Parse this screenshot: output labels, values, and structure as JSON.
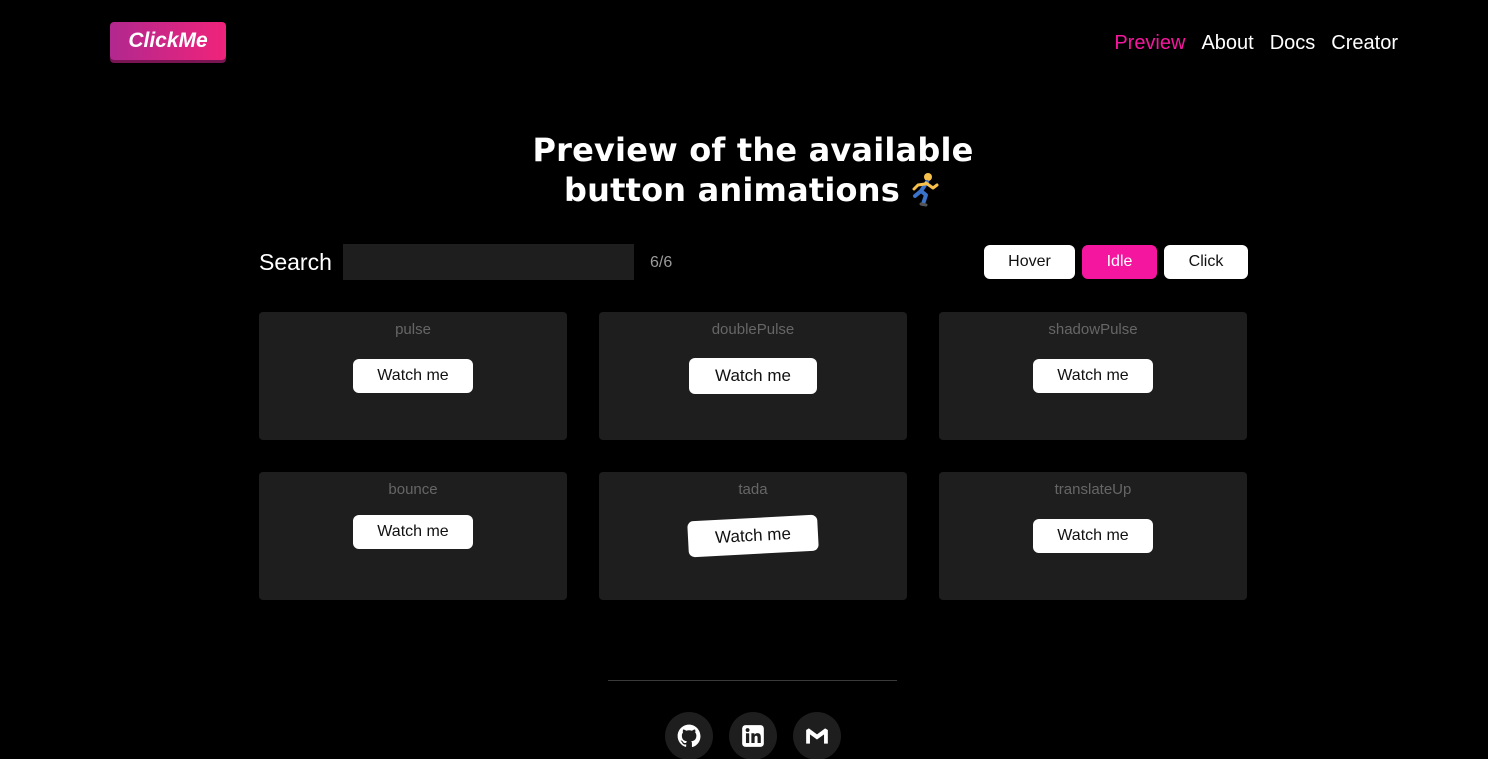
{
  "header": {
    "logo": "ClickMe",
    "nav": [
      {
        "label": "Preview",
        "active": true
      },
      {
        "label": "About",
        "active": false
      },
      {
        "label": "Docs",
        "active": false
      },
      {
        "label": "Creator",
        "active": false
      }
    ]
  },
  "heading": {
    "line1": "Preview of the available",
    "line2": "button animations"
  },
  "search": {
    "label": "Search",
    "value": "",
    "placeholder": "",
    "count": "6/6"
  },
  "modes": {
    "hover": "Hover",
    "idle": "Idle",
    "click": "Click",
    "active": "Idle"
  },
  "cards": [
    {
      "name": "pulse",
      "button": "Watch me"
    },
    {
      "name": "doublePulse",
      "button": "Watch me"
    },
    {
      "name": "shadowPulse",
      "button": "Watch me"
    },
    {
      "name": "bounce",
      "button": "Watch me"
    },
    {
      "name": "tada",
      "button": "Watch me"
    },
    {
      "name": "translateUp",
      "button": "Watch me"
    }
  ],
  "footer": {
    "social": [
      "github-icon",
      "linkedin-icon",
      "gmail-icon"
    ]
  },
  "colors": {
    "accent": "#f5169f",
    "background": "#000000",
    "card": "#1e1e1e"
  }
}
